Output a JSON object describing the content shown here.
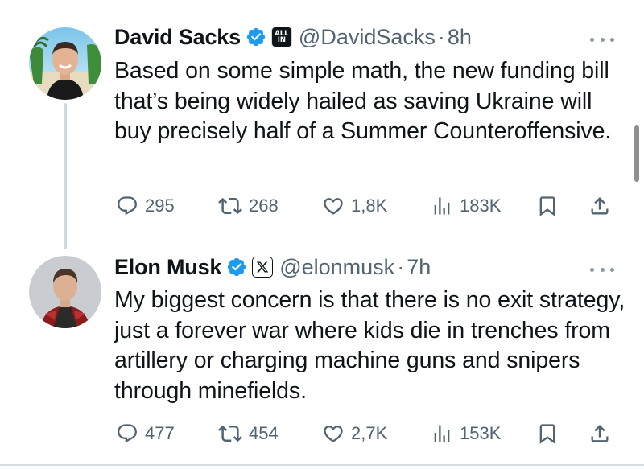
{
  "tweets": [
    {
      "display_name": "David Sacks",
      "affiliate_badge": "ALL IN",
      "handle": "@DavidSacks",
      "separator": "·",
      "time": "8h",
      "text": "Based on some simple math, the new funding bill that’s being widely hailed as saving Ukraine will buy precisely half of a Summer Counteroffensive.",
      "replies": "295",
      "retweets": "268",
      "likes": "1,8K",
      "views": "183K"
    },
    {
      "display_name": "Elon Musk",
      "affiliate_badge": "X",
      "handle": "@elonmusk",
      "separator": "·",
      "time": "7h",
      "text": "My biggest concern is that there is no exit strategy, just a forever war where kids die in trenches from artillery or charging machine guns and snipers through minefields.",
      "replies": "477",
      "retweets": "454",
      "likes": "2,7K",
      "views": "153K"
    }
  ],
  "colors": {
    "verified_blue": "#1d9bf0",
    "secondary_text": "#536471",
    "primary_text": "#0f1419",
    "thread_line": "#cfd9de"
  },
  "icons": [
    "verified-icon",
    "more-icon",
    "reply-icon",
    "retweet-icon",
    "like-icon",
    "views-icon",
    "bookmark-icon",
    "share-icon"
  ]
}
